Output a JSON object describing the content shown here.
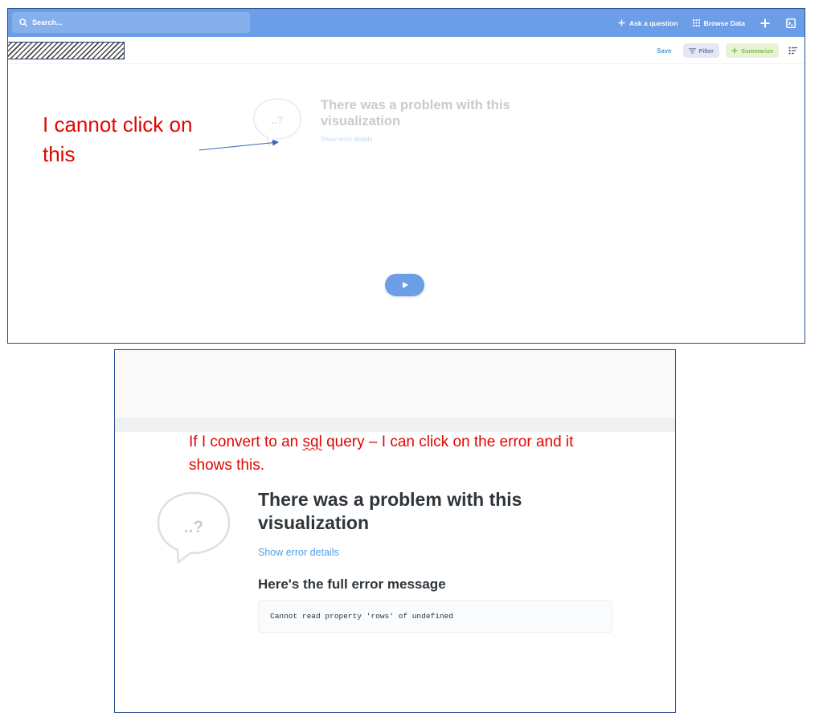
{
  "top_app": {
    "navbar": {
      "search_placeholder": "Search...",
      "ask_question_label": "Ask a question",
      "browse_data_label": "Browse Data",
      "icons": [
        "search-icon",
        "plus-icon",
        "grid-icon",
        "plus-icon",
        "terminal-icon"
      ]
    },
    "toolbar": {
      "save_label": "Save",
      "filter_label": "Filter",
      "summarize_label": "Summarize"
    },
    "visualization_error": {
      "bubble_text": "..?",
      "title": "There was a problem with this visualization",
      "details_link": "Show error details"
    },
    "annotation": "I cannot click on this",
    "run_button_icon": "play-icon"
  },
  "bottom_app": {
    "annotation_before": "If I convert to an ",
    "annotation_sql": "sql",
    "annotation_after": " query – I can click on the error and it shows this.",
    "bubble_text": "..?",
    "error_title": "There was a problem with this visualization",
    "details_link": "Show error details",
    "full_error_heading": "Here's the full error message",
    "error_message": "Cannot read property 'rows' of undefined"
  },
  "colors": {
    "navbar": "#6b9ee6",
    "annotation_red": "#e10600",
    "link_blue": "#509ee3",
    "filter_purple": "#7172ad",
    "summarize_green": "#84bb4c"
  }
}
